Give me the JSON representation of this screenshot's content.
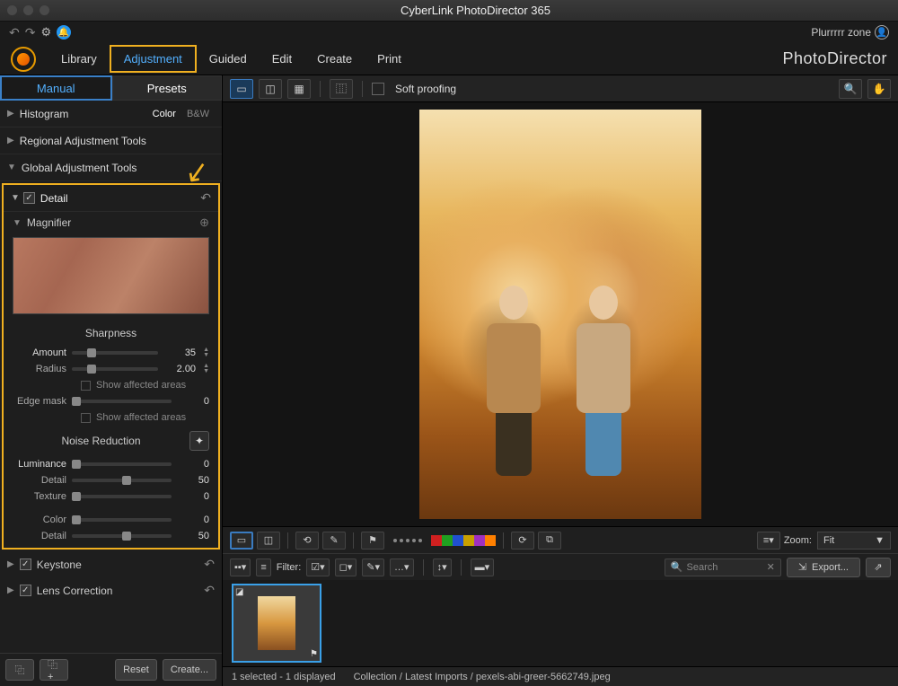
{
  "app_title": "CyberLink PhotoDirector 365",
  "user_zone": "Plurrrrr zone",
  "brand": "PhotoDirector",
  "modules": {
    "library": "Library",
    "adjustment": "Adjustment",
    "guided": "Guided",
    "edit": "Edit",
    "create": "Create",
    "print": "Print"
  },
  "left_tabs": {
    "manual": "Manual",
    "presets": "Presets"
  },
  "histogram": {
    "label": "Histogram",
    "color": "Color",
    "bw": "B&W"
  },
  "regional": "Regional Adjustment Tools",
  "global": "Global Adjustment Tools",
  "detail": {
    "label": "Detail",
    "magnifier": "Magnifier",
    "sharpness": {
      "title": "Sharpness",
      "amount_label": "Amount",
      "amount_val": "35",
      "radius_label": "Radius",
      "radius_val": "2.00",
      "affected1": "Show affected areas",
      "edge_label": "Edge mask",
      "edge_val": "0",
      "affected2": "Show affected areas"
    },
    "noise": {
      "title": "Noise Reduction",
      "luminance_label": "Luminance",
      "luminance_val": "0",
      "detail1_label": "Detail",
      "detail1_val": "50",
      "texture_label": "Texture",
      "texture_val": "0",
      "color_label": "Color",
      "color_val": "0",
      "detail2_label": "Detail",
      "detail2_val": "50"
    }
  },
  "keystone": "Keystone",
  "lens": "Lens Correction",
  "reset": "Reset",
  "create_btn": "Create...",
  "soft_proof": "Soft proofing",
  "zoom_label": "Zoom:",
  "zoom_val": "Fit",
  "filter_label": "Filter:",
  "search_placeholder": "Search",
  "export": "Export...",
  "status_selected": "1 selected - 1 displayed",
  "status_path": "Collection / Latest Imports / pexels-abi-greer-5662749.jpeg",
  "swatches": [
    "#d02020",
    "#20a020",
    "#2050d0",
    "#c8a000",
    "#a030c0",
    "#ff8000"
  ]
}
